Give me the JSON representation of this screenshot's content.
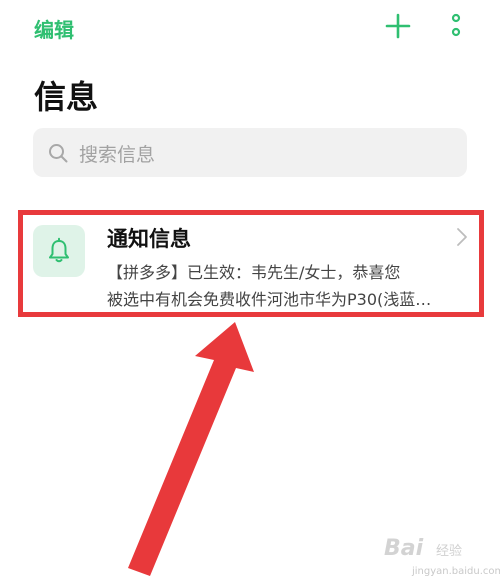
{
  "header": {
    "edit_label": "编辑",
    "add_icon": "plus-icon",
    "more_icon": "more-vertical-icon"
  },
  "page": {
    "title": "信息"
  },
  "search": {
    "placeholder": "搜索信息"
  },
  "messages": [
    {
      "title": "通知信息",
      "line1": "【拼多多】已生效：韦先生/女士，恭喜您",
      "line2": "被选中有机会免费收件河池市华为P30(浅蓝…",
      "icon": "bell-icon"
    }
  ],
  "colors": {
    "accent": "#2fbf71",
    "highlight_border": "#e83a3c",
    "annotation_arrow": "#e8393b"
  },
  "watermark": {
    "logo": "Bai",
    "cn": "经验",
    "url": "jingyan.baidu.com"
  }
}
